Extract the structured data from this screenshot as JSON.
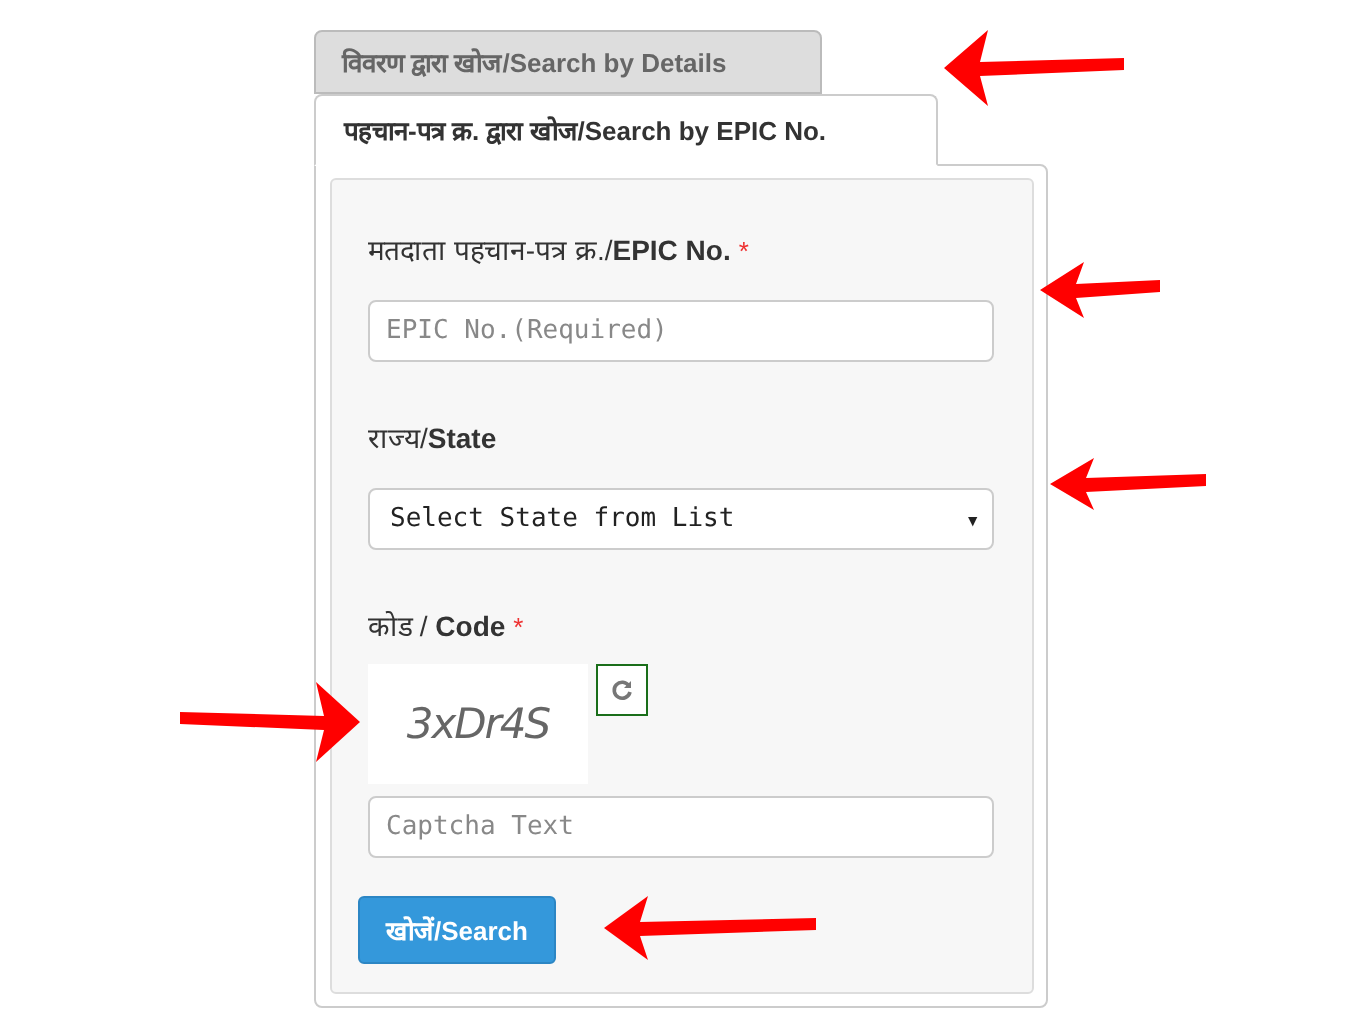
{
  "tabs": [
    {
      "label": "विवरण द्वारा खोज/Search by Details",
      "selected": false
    },
    {
      "label": "पहचान-पत्र क्र. द्वारा खोज/Search by EPIC No.",
      "selected": true
    }
  ],
  "form": {
    "fields": [
      {
        "kind": "input",
        "label": "मतदाता पहचान-पत्र क्र./**EPIC No.**",
        "required_mark": "*",
        "placeholder": "EPIC No.(Required)"
      },
      {
        "kind": "select",
        "label": "राज्य/**State**",
        "value": "Select State from List",
        "caret": "▾"
      },
      {
        "kind": "captcha",
        "label": "कोड / **Code**",
        "required_mark": "*",
        "captcha_text": "3xDr4S",
        "placeholder": "Captcha Text"
      }
    ],
    "submit": "खोजें/Search"
  }
}
